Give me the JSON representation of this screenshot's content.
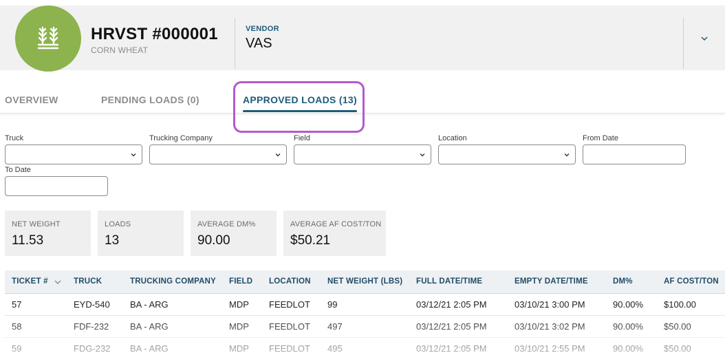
{
  "header": {
    "title": "HRVST #000001",
    "subtitle": "CORN WHEAT",
    "vendor_label": "VENDOR",
    "vendor_value": "VAS",
    "avatar_icon": "wheat-icon",
    "avatar_color": "#8cb34d"
  },
  "tabs": [
    {
      "label": "OVERVIEW"
    },
    {
      "label": "PENDING LOADS (0)"
    },
    {
      "label": "APPROVED LOADS (13)"
    }
  ],
  "filters": {
    "truck": "Truck",
    "trucking_company": "Trucking Company",
    "field": "Field",
    "location": "Location",
    "from_date": "From Date",
    "to_date": "To Date"
  },
  "stats": [
    {
      "label": "NET WEIGHT",
      "value": "11.53"
    },
    {
      "label": "LOADS",
      "value": "13"
    },
    {
      "label": "AVERAGE DM%",
      "value": "90.00"
    },
    {
      "label": "AVERAGE AF COST/TON",
      "value": "$50.21"
    }
  ],
  "table": {
    "headers": [
      "TICKET #",
      "TRUCK",
      "TRUCKING COMPANY",
      "FIELD",
      "LOCATION",
      "NET WEIGHT (LBS)",
      "FULL DATE/TIME",
      "EMPTY DATE/TIME",
      "DM%",
      "AF COST/TON"
    ],
    "rows": [
      [
        "57",
        "EYD-540",
        "BA - ARG",
        "MDP",
        "FEEDLOT",
        "99",
        "03/12/21 2:05 PM",
        "03/10/21 3:00 PM",
        "90.00%",
        "$100.00"
      ],
      [
        "58",
        "FDF-232",
        "BA - ARG",
        "MDP",
        "FEEDLOT",
        "497",
        "03/12/21 2:05 PM",
        "03/10/21 3:02 PM",
        "90.00%",
        "$50.00"
      ],
      [
        "59",
        "FDG-232",
        "BA - ARG",
        "MDP",
        "FEEDLOT",
        "495",
        "03/12/21 2:05 PM",
        "03/10/21 2:55 PM",
        "90.00%",
        "$50.00"
      ]
    ]
  },
  "colors": {
    "accent": "#1f5a7a",
    "highlight": "#b05ad0"
  }
}
